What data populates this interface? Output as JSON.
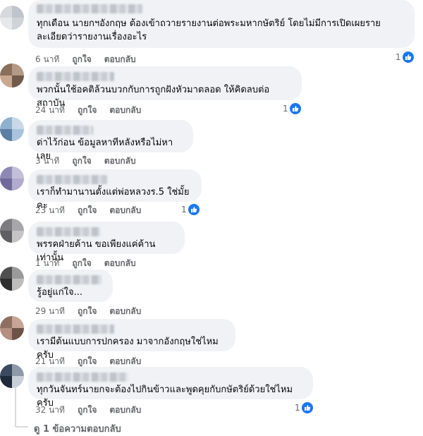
{
  "comments": [
    {
      "text": "ทุกเดือน นายกฯอังกฤษ ต้องเข้าถวายรายงานต่อพระมหากษัตริย์ โดยไม่มีการเปิดเผยรายละเอียดว่ารายงานเรื่องอะไร",
      "time": "6 นาที",
      "like": "ถูกใจ",
      "reply": "ตอบกลับ",
      "reactions": "1",
      "avatar_colors": [
        "#d6d9dd",
        "#bfc5cb",
        "#e6e8ea",
        "#cfd3d8"
      ]
    },
    {
      "text": "พวกนั้นใช้อคติล้วนบวกกับการถูกฝังหัวมาตลอด ให้คิดลบต่อสถาบัน",
      "time": "24 นาที",
      "like": "ถูกใจ",
      "reply": "ตอบกลับ",
      "reactions": "1",
      "avatar_colors": [
        "#8a6f5c",
        "#b39a86",
        "#c9a88f",
        "#6f5a4b"
      ]
    },
    {
      "text": "ด่าไว้ก่อน ข้อมูลหาทีหลังหรือไม่หาเลย",
      "time": "3 นาที",
      "like": "ถูกใจ",
      "reply": "ตอบกลับ",
      "reactions": "",
      "avatar_colors": [
        "#8fb0cf",
        "#c9d8e6",
        "#5d7fa3",
        "#a9c3dc"
      ]
    },
    {
      "text": "เราก็ทำมานานตั้งแต่พ่อหลวงร.5 ใช่มั้ยคะ",
      "time": "23 นาที",
      "like": "ถูกใจ",
      "reply": "ตอบกลับ",
      "reactions": "1",
      "avatar_colors": [
        "#8e88b4",
        "#c3bfd9",
        "#6f6a99",
        "#b0abcf"
      ]
    },
    {
      "text": "พรรคฝ่ายค้าน ขอเพียงแค่ค้านเท่านั้น",
      "time": "1 นาที",
      "like": "ถูกใจ",
      "reply": "ตอบกลับ",
      "reactions": "",
      "avatar_colors": [
        "#7b7b80",
        "#a7a7ab",
        "#5e5e63",
        "#c4c4c7"
      ]
    },
    {
      "text": "รู้อยู่แก่ใจ...",
      "time": "29 นาที",
      "like": "ถูกใจ",
      "reply": "ตอบกลับ",
      "reactions": "",
      "avatar_colors": [
        "#4f4f4f",
        "#9a9a9a",
        "#2d2d2d",
        "#bdbdbd"
      ]
    },
    {
      "text": "เรามีต้นแบบการปกครอง มาจากอังกฤษใช่ไหมครับ",
      "time": "21 นาที",
      "like": "ถูกใจ",
      "reply": "ตอบกลับ",
      "reactions": "",
      "avatar_colors": [
        "#8f6f62",
        "#c6a596",
        "#b48e80",
        "#6d5247"
      ]
    },
    {
      "text": "ทุกวันจันทร์นายกจะต้องไปกินข้าวและพูดคุยกับกษัตริย์ด้วยใช่ไหมครับ",
      "time": "32 นาที",
      "like": "ถูกใจ",
      "reply": "ตอบกลับ",
      "reactions": "1",
      "avatar_colors": [
        "#3b4a5e",
        "#8d98a8",
        "#1f2a3a",
        "#c9cfd8"
      ]
    }
  ],
  "view_replies": "ดู 1 ข้อความตอบกลับ",
  "colors": {
    "bubble": "#f0f2f5",
    "meta": "#65676b",
    "like_blue": "#1877f2"
  }
}
